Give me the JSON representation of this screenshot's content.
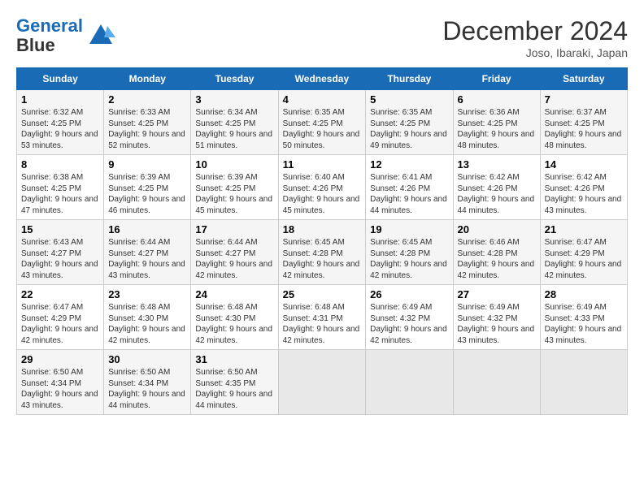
{
  "header": {
    "logo_line1": "General",
    "logo_line2": "Blue",
    "month": "December 2024",
    "location": "Joso, Ibaraki, Japan"
  },
  "days_of_week": [
    "Sunday",
    "Monday",
    "Tuesday",
    "Wednesday",
    "Thursday",
    "Friday",
    "Saturday"
  ],
  "weeks": [
    [
      {
        "day": 1,
        "sunrise": "6:32 AM",
        "sunset": "4:25 PM",
        "daylight": "9 hours and 53 minutes."
      },
      {
        "day": 2,
        "sunrise": "6:33 AM",
        "sunset": "4:25 PM",
        "daylight": "9 hours and 52 minutes."
      },
      {
        "day": 3,
        "sunrise": "6:34 AM",
        "sunset": "4:25 PM",
        "daylight": "9 hours and 51 minutes."
      },
      {
        "day": 4,
        "sunrise": "6:35 AM",
        "sunset": "4:25 PM",
        "daylight": "9 hours and 50 minutes."
      },
      {
        "day": 5,
        "sunrise": "6:35 AM",
        "sunset": "4:25 PM",
        "daylight": "9 hours and 49 minutes."
      },
      {
        "day": 6,
        "sunrise": "6:36 AM",
        "sunset": "4:25 PM",
        "daylight": "9 hours and 48 minutes."
      },
      {
        "day": 7,
        "sunrise": "6:37 AM",
        "sunset": "4:25 PM",
        "daylight": "9 hours and 48 minutes."
      }
    ],
    [
      {
        "day": 8,
        "sunrise": "6:38 AM",
        "sunset": "4:25 PM",
        "daylight": "9 hours and 47 minutes."
      },
      {
        "day": 9,
        "sunrise": "6:39 AM",
        "sunset": "4:25 PM",
        "daylight": "9 hours and 46 minutes."
      },
      {
        "day": 10,
        "sunrise": "6:39 AM",
        "sunset": "4:25 PM",
        "daylight": "9 hours and 45 minutes."
      },
      {
        "day": 11,
        "sunrise": "6:40 AM",
        "sunset": "4:26 PM",
        "daylight": "9 hours and 45 minutes."
      },
      {
        "day": 12,
        "sunrise": "6:41 AM",
        "sunset": "4:26 PM",
        "daylight": "9 hours and 44 minutes."
      },
      {
        "day": 13,
        "sunrise": "6:42 AM",
        "sunset": "4:26 PM",
        "daylight": "9 hours and 44 minutes."
      },
      {
        "day": 14,
        "sunrise": "6:42 AM",
        "sunset": "4:26 PM",
        "daylight": "9 hours and 43 minutes."
      }
    ],
    [
      {
        "day": 15,
        "sunrise": "6:43 AM",
        "sunset": "4:27 PM",
        "daylight": "9 hours and 43 minutes."
      },
      {
        "day": 16,
        "sunrise": "6:44 AM",
        "sunset": "4:27 PM",
        "daylight": "9 hours and 43 minutes."
      },
      {
        "day": 17,
        "sunrise": "6:44 AM",
        "sunset": "4:27 PM",
        "daylight": "9 hours and 42 minutes."
      },
      {
        "day": 18,
        "sunrise": "6:45 AM",
        "sunset": "4:28 PM",
        "daylight": "9 hours and 42 minutes."
      },
      {
        "day": 19,
        "sunrise": "6:45 AM",
        "sunset": "4:28 PM",
        "daylight": "9 hours and 42 minutes."
      },
      {
        "day": 20,
        "sunrise": "6:46 AM",
        "sunset": "4:28 PM",
        "daylight": "9 hours and 42 minutes."
      },
      {
        "day": 21,
        "sunrise": "6:47 AM",
        "sunset": "4:29 PM",
        "daylight": "9 hours and 42 minutes."
      }
    ],
    [
      {
        "day": 22,
        "sunrise": "6:47 AM",
        "sunset": "4:29 PM",
        "daylight": "9 hours and 42 minutes."
      },
      {
        "day": 23,
        "sunrise": "6:48 AM",
        "sunset": "4:30 PM",
        "daylight": "9 hours and 42 minutes."
      },
      {
        "day": 24,
        "sunrise": "6:48 AM",
        "sunset": "4:30 PM",
        "daylight": "9 hours and 42 minutes."
      },
      {
        "day": 25,
        "sunrise": "6:48 AM",
        "sunset": "4:31 PM",
        "daylight": "9 hours and 42 minutes."
      },
      {
        "day": 26,
        "sunrise": "6:49 AM",
        "sunset": "4:32 PM",
        "daylight": "9 hours and 42 minutes."
      },
      {
        "day": 27,
        "sunrise": "6:49 AM",
        "sunset": "4:32 PM",
        "daylight": "9 hours and 43 minutes."
      },
      {
        "day": 28,
        "sunrise": "6:49 AM",
        "sunset": "4:33 PM",
        "daylight": "9 hours and 43 minutes."
      }
    ],
    [
      {
        "day": 29,
        "sunrise": "6:50 AM",
        "sunset": "4:34 PM",
        "daylight": "9 hours and 43 minutes."
      },
      {
        "day": 30,
        "sunrise": "6:50 AM",
        "sunset": "4:34 PM",
        "daylight": "9 hours and 44 minutes."
      },
      {
        "day": 31,
        "sunrise": "6:50 AM",
        "sunset": "4:35 PM",
        "daylight": "9 hours and 44 minutes."
      },
      null,
      null,
      null,
      null
    ]
  ]
}
